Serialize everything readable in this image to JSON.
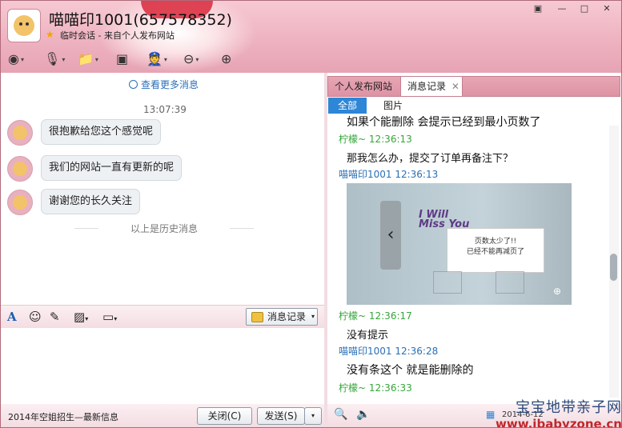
{
  "window": {
    "title": "喵喵印1001(657578352)",
    "subtitle": "临时会话 - 来自个人发布网站",
    "controls": [
      "▣",
      "—",
      "□",
      "✕"
    ]
  },
  "chat": {
    "more_messages": "查看更多消息",
    "time": "13:07:39",
    "messages": [
      {
        "text": "很抱歉给您这个感觉呢"
      },
      {
        "text": "我们的网站一直有更新的呢"
      },
      {
        "text": "谢谢您的长久关注"
      }
    ],
    "history_divider": "以上是历史消息"
  },
  "input_toolbar": {
    "history_button": "消息记录"
  },
  "footer": {
    "ad_text": "2014年空姐招生—最新信息",
    "close_button": "关闭(C)",
    "send_button": "发送(S)"
  },
  "right_panel": {
    "tabs": [
      {
        "label": "个人发布网站"
      },
      {
        "label": "消息记录",
        "close": "✕"
      }
    ],
    "filters": [
      {
        "label": "全部"
      },
      {
        "label": "图片"
      }
    ],
    "records": [
      {
        "text": "如果个能删除 会提示已经到最小页数了"
      },
      {
        "sender": "柠檬~ 12:36:13"
      },
      {
        "text": "那我怎么办，提交了订单再备注下？"
      },
      {
        "sender": "喵喵印1001 12:36:13"
      },
      {
        "sender": "柠檬~ 12:36:17"
      },
      {
        "text": "没有提示"
      },
      {
        "sender": "喵喵印1001 12:36:28"
      },
      {
        "text": "没有条这个 就是能删除的"
      },
      {
        "sender": "柠檬~ 12:36:33"
      }
    ],
    "image": {
      "title": "I Will\nMiss You",
      "card_lines": [
        "页数太少了!!",
        "已经不能再减页了"
      ]
    },
    "date": "2014-6-12"
  },
  "watermark": {
    "line1": "宝宝地带亲子网",
    "line2": "www.ibabyzone.cn"
  },
  "colors": {
    "accent": "#2d86d6",
    "sender_green": "#36a53a",
    "sender_blue": "#2a6fb6",
    "header_pink": "#eeb2c0"
  }
}
